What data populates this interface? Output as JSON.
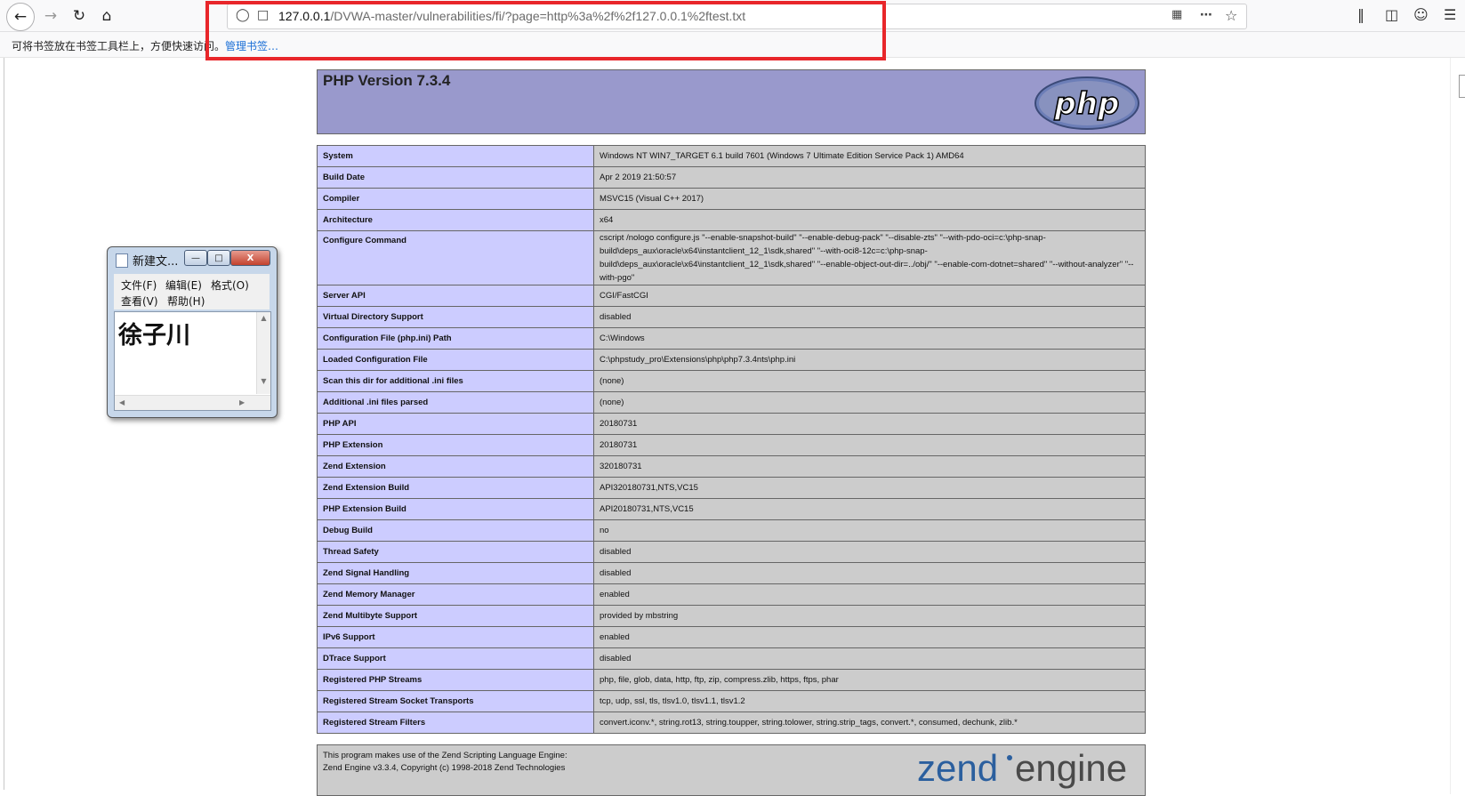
{
  "browser": {
    "url_host": "127.0.0.1",
    "url_path": "/DVWA-master/vulnerabilities/fi/?page=http%3a%2f%2f127.0.0.1%2ftest.txt",
    "icons": {
      "back": "back-arrow-icon",
      "forward": "forward-arrow-icon",
      "reload": "reload-icon",
      "home": "home-icon",
      "shield": "shield-icon",
      "page": "page-icon",
      "qr": "qr-code-icon",
      "more": "more-dots-icon",
      "star": "bookmark-star-icon",
      "library": "library-icon",
      "sidebar": "sidebar-icon",
      "account": "account-icon",
      "menu": "hamburger-menu-icon"
    },
    "highlight_color": "#e8262a"
  },
  "bookmarks_bar": {
    "hint": "可将书签放在书签工具栏上，方便快速访问。",
    "manage_link": "管理书签…"
  },
  "phpinfo": {
    "title": "PHP Version 7.3.4",
    "logo_text": "php",
    "rows": [
      {
        "key": "System",
        "value": "Windows NT WIN7_TARGET 6.1 build 7601 (Windows 7 Ultimate Edition Service Pack 1) AMD64"
      },
      {
        "key": "Build Date",
        "value": "Apr 2 2019 21:50:57"
      },
      {
        "key": "Compiler",
        "value": "MSVC15 (Visual C++ 2017)"
      },
      {
        "key": "Architecture",
        "value": "x64"
      },
      {
        "key": "Configure Command",
        "value": "cscript /nologo configure.js \"--enable-snapshot-build\" \"--enable-debug-pack\" \"--disable-zts\" \"--with-pdo-oci=c:\\php-snap-build\\deps_aux\\oracle\\x64\\instantclient_12_1\\sdk,shared\" \"--with-oci8-12c=c:\\php-snap-build\\deps_aux\\oracle\\x64\\instantclient_12_1\\sdk,shared\" \"--enable-object-out-dir=../obj/\" \"--enable-com-dotnet=shared\" \"--without-analyzer\" \"--with-pgo\"",
        "tall": true
      },
      {
        "key": "Server API",
        "value": "CGI/FastCGI"
      },
      {
        "key": "Virtual Directory Support",
        "value": "disabled"
      },
      {
        "key": "Configuration File (php.ini) Path",
        "value": "C:\\Windows"
      },
      {
        "key": "Loaded Configuration File",
        "value": "C:\\phpstudy_pro\\Extensions\\php\\php7.3.4nts\\php.ini"
      },
      {
        "key": "Scan this dir for additional .ini files",
        "value": "(none)"
      },
      {
        "key": "Additional .ini files parsed",
        "value": "(none)"
      },
      {
        "key": "PHP API",
        "value": "20180731"
      },
      {
        "key": "PHP Extension",
        "value": "20180731"
      },
      {
        "key": "Zend Extension",
        "value": "320180731"
      },
      {
        "key": "Zend Extension Build",
        "value": "API320180731,NTS,VC15"
      },
      {
        "key": "PHP Extension Build",
        "value": "API20180731,NTS,VC15"
      },
      {
        "key": "Debug Build",
        "value": "no"
      },
      {
        "key": "Thread Safety",
        "value": "disabled"
      },
      {
        "key": "Zend Signal Handling",
        "value": "disabled"
      },
      {
        "key": "Zend Memory Manager",
        "value": "enabled"
      },
      {
        "key": "Zend Multibyte Support",
        "value": "provided by mbstring"
      },
      {
        "key": "IPv6 Support",
        "value": "enabled"
      },
      {
        "key": "DTrace Support",
        "value": "disabled"
      },
      {
        "key": "Registered PHP Streams",
        "value": "php, file, glob, data, http, ftp, zip, compress.zlib, https, ftps, phar"
      },
      {
        "key": "Registered Stream Socket Transports",
        "value": "tcp, udp, ssl, tls, tlsv1.0, tlsv1.1, tlsv1.2"
      },
      {
        "key": "Registered Stream Filters",
        "value": "convert.iconv.*, string.rot13, string.toupper, string.tolower, string.strip_tags, convert.*, consumed, dechunk, zlib.*"
      }
    ],
    "zend_line1": "This program makes use of the Zend Scripting Language Engine:",
    "zend_line2": "Zend Engine v3.3.4, Copyright (c) 1998-2018 Zend Technologies",
    "zend_logo_word1": "zend",
    "zend_logo_word2": "engine",
    "colors": {
      "header": "#9999cc",
      "key_cell": "#ccccff",
      "value_cell": "#cccccc"
    }
  },
  "notepad": {
    "title": "新建文...",
    "menu": [
      "文件(F)",
      "编辑(E)",
      "格式(O)",
      "查看(V)",
      "帮助(H)"
    ],
    "content": "徐子川",
    "minimize": "—",
    "maximize": "□",
    "close": "X"
  }
}
